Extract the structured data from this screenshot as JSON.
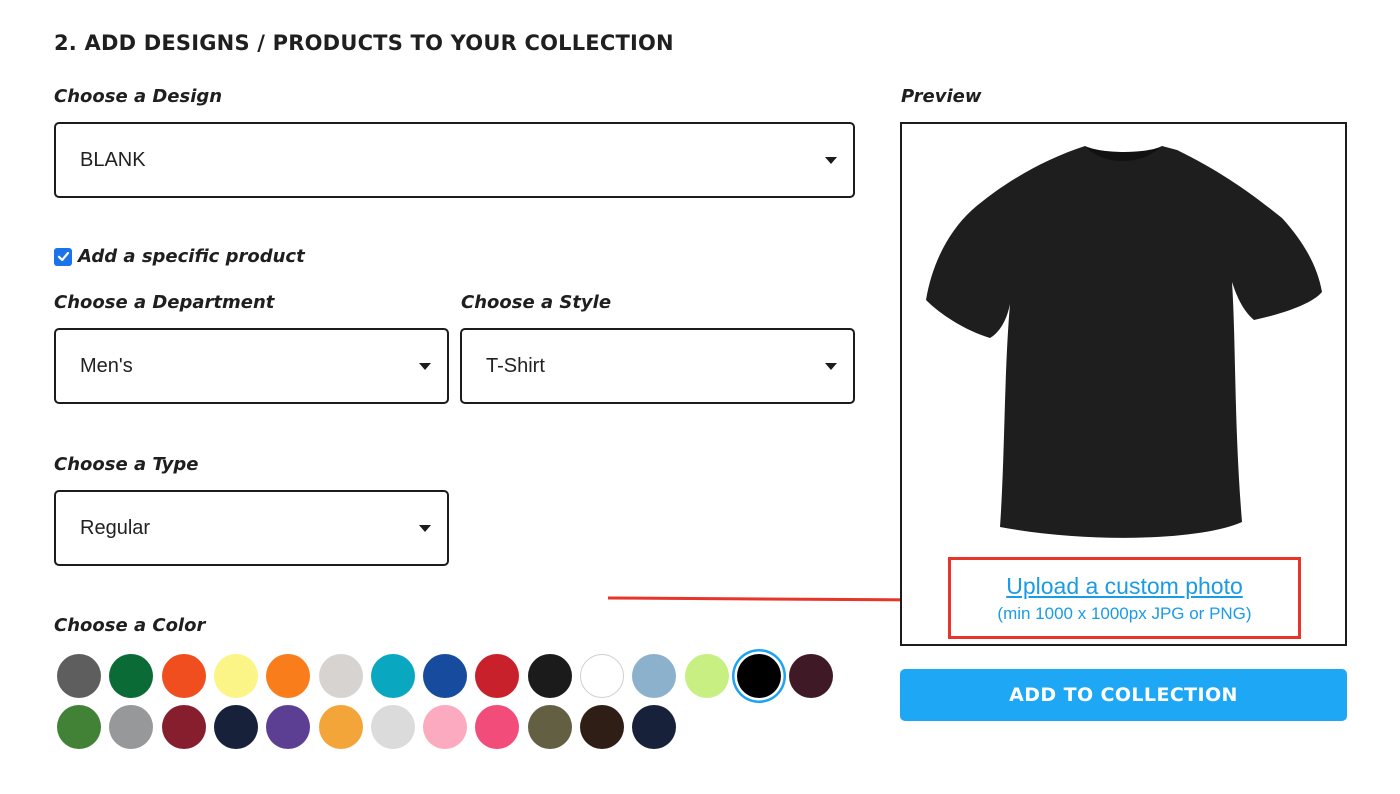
{
  "section": {
    "title": "2. ADD DESIGNS / PRODUCTS TO YOUR COLLECTION"
  },
  "design": {
    "label": "Choose a Design",
    "value": "BLANK"
  },
  "specific_product": {
    "label": "Add a specific product",
    "checked": true
  },
  "department": {
    "label": "Choose a Department",
    "value": "Men's"
  },
  "style": {
    "label": "Choose a Style",
    "value": "T-Shirt"
  },
  "type": {
    "label": "Choose a Type",
    "value": "Regular"
  },
  "color": {
    "label": "Choose a Color",
    "selected_index": 13,
    "swatches": [
      "#5e5e5e",
      "#0a6b36",
      "#f04e1e",
      "#fbf486",
      "#fa7d1c",
      "#d6d3d0",
      "#0aa8c0",
      "#164b9e",
      "#c8212b",
      "#1b1b1b",
      "#ffffff",
      "#8bb1cd",
      "#c7ef82",
      "#000000",
      "#3f1a26",
      "#418236",
      "#979899",
      "#861e2e",
      "#17213a",
      "#5c3f93",
      "#f4a53a",
      "#dbdbdb",
      "#fbaac0",
      "#f24c7b",
      "#625f43",
      "#2f1e16",
      "#17213a"
    ]
  },
  "preview": {
    "label": "Preview",
    "upload_link": "Upload a custom photo",
    "upload_hint": "(min 1000 x 1000px JPG or PNG)"
  },
  "actions": {
    "add_label": "ADD TO COLLECTION"
  },
  "colors": {
    "accent": "#1ea7f4",
    "highlight": "#e8342a",
    "link": "#1a9be6"
  }
}
